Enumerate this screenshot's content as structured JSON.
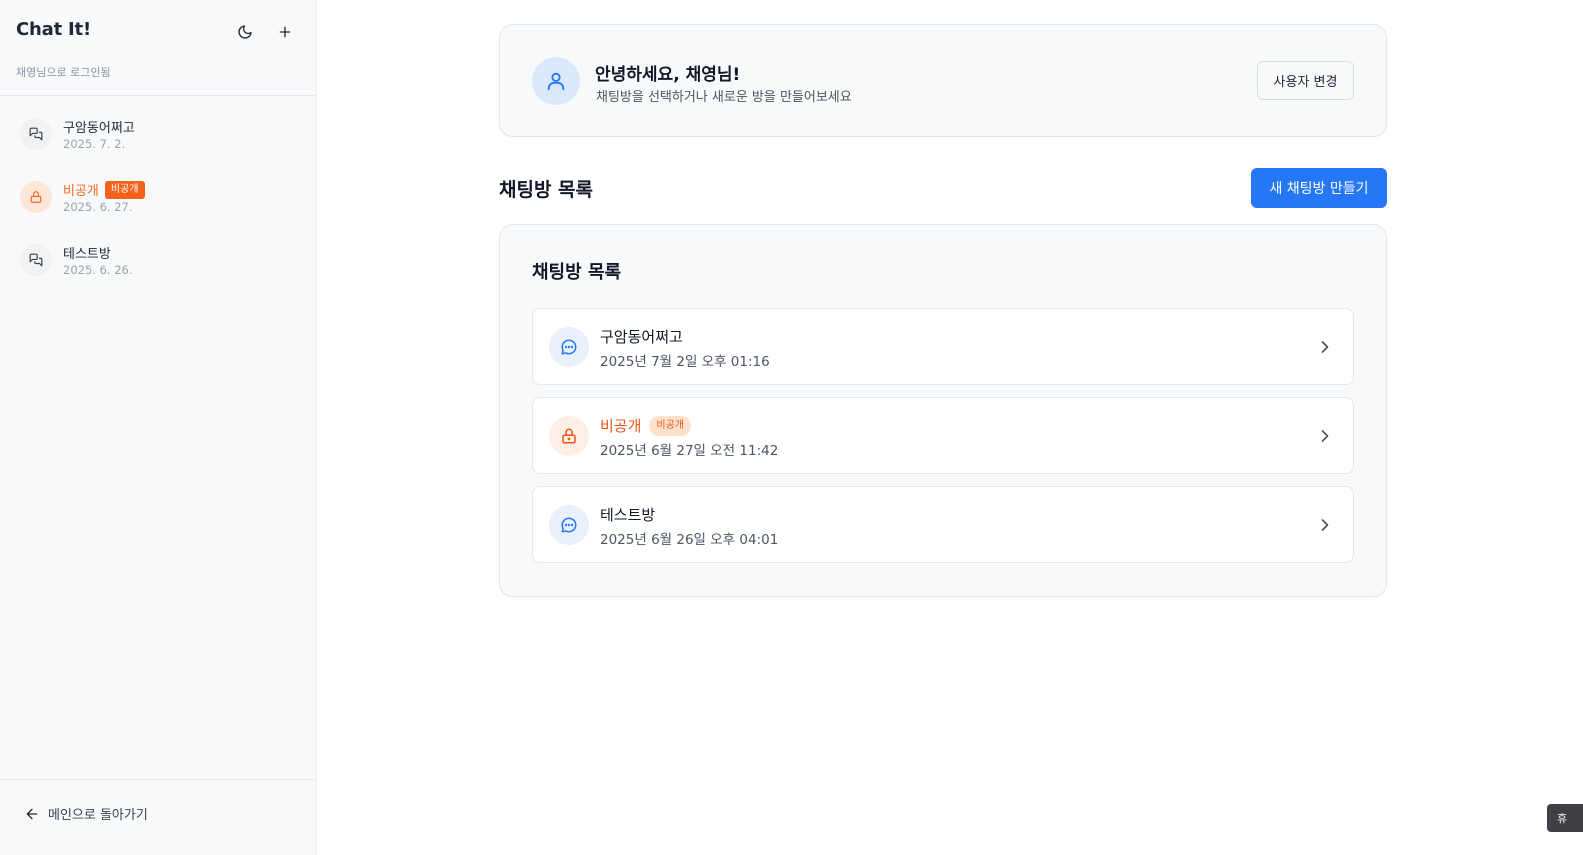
{
  "sidebar": {
    "title": "Chat It!",
    "subtitle": "채영님으로 로그인됨",
    "rooms": [
      {
        "name": "구암동어쩌고",
        "date": "2025. 7. 2.",
        "private": false
      },
      {
        "name": "비공개",
        "badge": "비공개",
        "date": "2025. 6. 27.",
        "private": true
      },
      {
        "name": "테스트방",
        "date": "2025. 6. 26.",
        "private": false
      }
    ],
    "back_label": "메인으로 돌아가기"
  },
  "welcome": {
    "title": "안녕하세요, 채영님!",
    "subtitle": "채팅방을 선택하거나 새로운 방을 만들어보세요",
    "change_user_label": "사용자 변경"
  },
  "section": {
    "title": "채팅방 목록",
    "new_room_label": "새 채팅방 만들기"
  },
  "list": {
    "title": "채팅방 목록",
    "rooms": [
      {
        "name": "구암동어쩌고",
        "date": "2025년 7월 2일 오후 01:16",
        "private": false
      },
      {
        "name": "비공개",
        "badge": "비공개",
        "date": "2025년 6월 27일 오전 11:42",
        "private": true
      },
      {
        "name": "테스트방",
        "date": "2025년 6월 26일 오후 04:01",
        "private": false
      }
    ]
  },
  "floating": {
    "label": "휴"
  },
  "colors": {
    "primary": "#2577f5",
    "private": "#f06a1d",
    "sidebar_bg": "#f8f9fb"
  }
}
